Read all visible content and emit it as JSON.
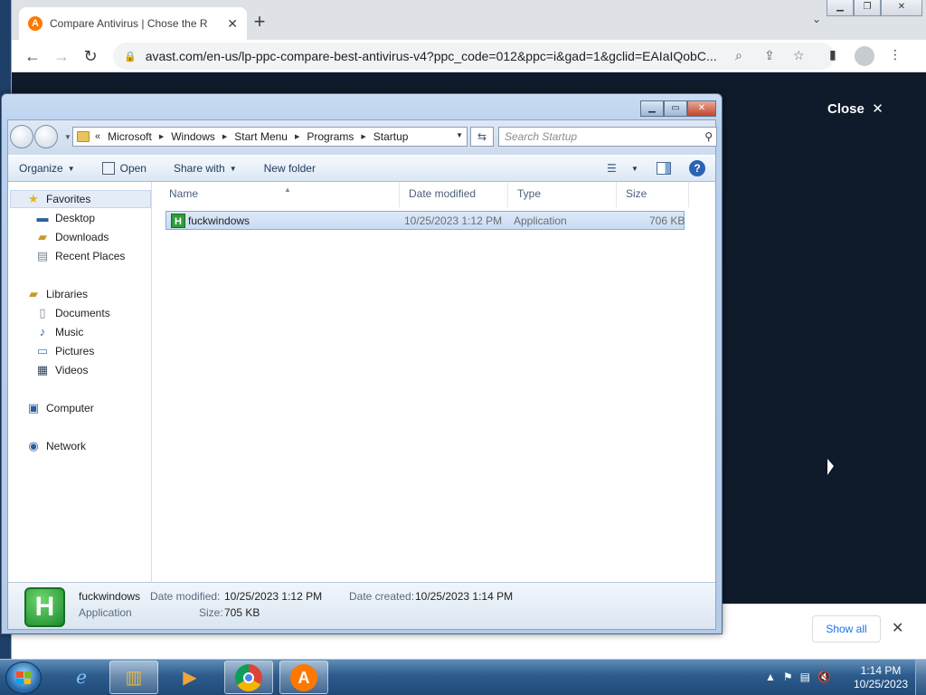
{
  "browser": {
    "tab_title": "Compare Antivirus | Chose the R",
    "url": "avast.com/en-us/lp-ppc-compare-best-antivirus-v4?ppc_code=012&ppc=i&gad=1&gclid=EAIaIQobC...",
    "page_close_label": "Close",
    "show_all_label": "Show all"
  },
  "explorer": {
    "breadcrumbs": [
      "Microsoft",
      "Windows",
      "Start Menu",
      "Programs",
      "Startup"
    ],
    "search_placeholder": "Search Startup",
    "commands": {
      "organize": "Organize",
      "open": "Open",
      "share_with": "Share with",
      "new_folder": "New folder"
    },
    "nav": {
      "favorites": "Favorites",
      "desktop": "Desktop",
      "downloads": "Downloads",
      "recent_places": "Recent Places",
      "libraries": "Libraries",
      "documents": "Documents",
      "music": "Music",
      "pictures": "Pictures",
      "videos": "Videos",
      "computer": "Computer",
      "network": "Network"
    },
    "columns": {
      "name": "Name",
      "date_modified": "Date modified",
      "type": "Type",
      "size": "Size"
    },
    "files": [
      {
        "name": "fuckwindows",
        "date_modified": "10/25/2023 1:12 PM",
        "type": "Application",
        "size": "706 KB"
      }
    ],
    "details": {
      "name": "fuckwindows",
      "kind": "Application",
      "date_modified_label": "Date modified:",
      "date_modified": "10/25/2023 1:12 PM",
      "date_created_label": "Date created:",
      "date_created": "10/25/2023 1:14 PM",
      "size_label": "Size:",
      "size": "705 KB"
    }
  },
  "taskbar": {
    "time": "1:14 PM",
    "date": "10/25/2023"
  },
  "colors": {
    "explorer_frame": "#b8d0ee",
    "selection": "#c9dcf3",
    "taskbar": "#2c5b8c",
    "avast_orange": "#ff7800",
    "page_dark": "#0f1b2a"
  }
}
